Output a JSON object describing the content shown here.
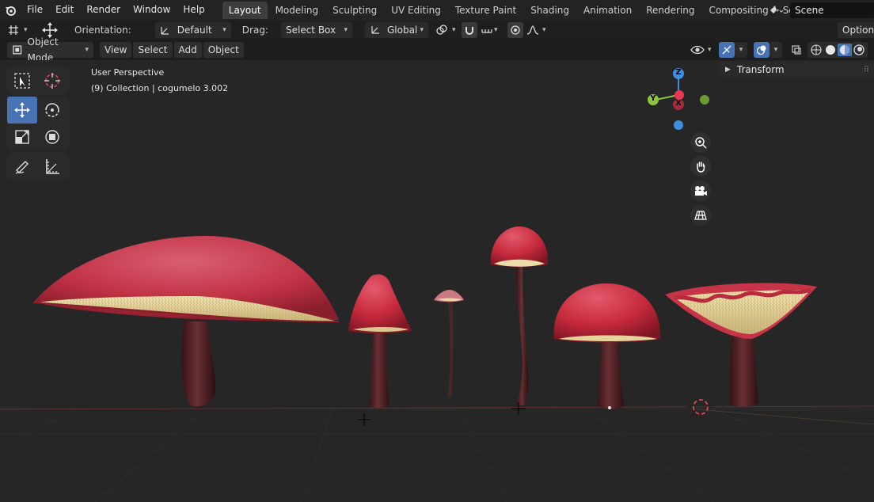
{
  "menu": {
    "items": [
      "File",
      "Edit",
      "Render",
      "Window",
      "Help"
    ]
  },
  "workspaces": {
    "tabs": [
      "Layout",
      "Modeling",
      "Sculpting",
      "UV Editing",
      "Texture Paint",
      "Shading",
      "Animation",
      "Rendering",
      "Compositing",
      "Scripting"
    ],
    "active": "Layout"
  },
  "scene": {
    "name": "Scene"
  },
  "tool_header": {
    "orientation_label": "Orientation:",
    "orientation_value": "Default",
    "drag_label": "Drag:",
    "drag_value": "Select Box",
    "transform_orientation": "Global",
    "options_label": "Options"
  },
  "viewport_header": {
    "mode": "Object Mode",
    "menus": [
      "View",
      "Select",
      "Add",
      "Object"
    ]
  },
  "viewport": {
    "perspective_label": "User Perspective",
    "collection_label": "(9) Collection | cogumelo 3.002"
  },
  "sidebar": {
    "transform_label": "Transform"
  },
  "gizmo": {
    "z": "Z",
    "y": "Y",
    "x": "X"
  },
  "colors": {
    "accent": "#4772b3",
    "axis_x": "#e8384f",
    "axis_y": "#8bc43f",
    "axis_z": "#3d8fe0",
    "cap_red": "#c8364a",
    "gills_cream": "#e3d29b",
    "stem_brown": "#4a1f22"
  }
}
